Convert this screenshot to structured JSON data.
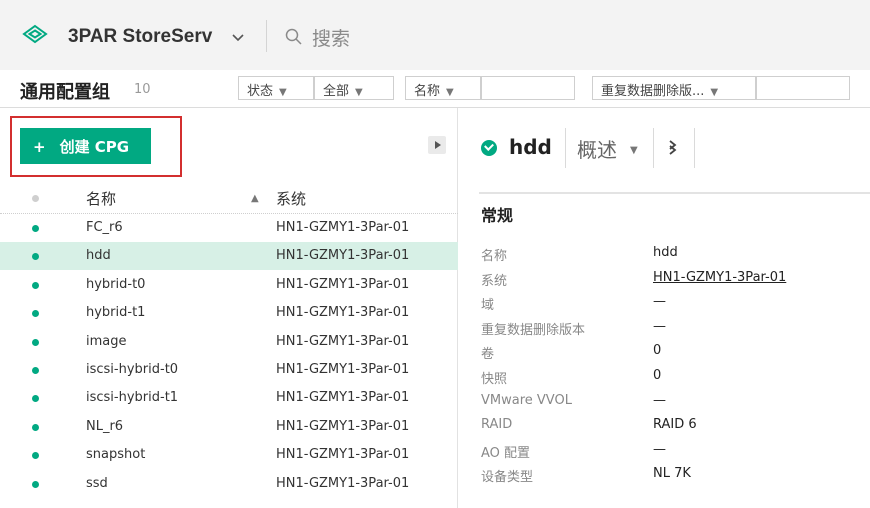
{
  "header": {
    "product_name": "3PAR StoreServ",
    "search_placeholder": "搜索"
  },
  "filterbar": {
    "title": "通用配置组",
    "count": "10",
    "filters": [
      {
        "label": "状态",
        "value": "全部"
      },
      {
        "label": "名称",
        "value": ""
      },
      {
        "label": "重复数据删除版...",
        "value": ""
      }
    ]
  },
  "actions": {
    "create_label": "创建 CPG",
    "plus": "+"
  },
  "table": {
    "columns": {
      "name": "名称",
      "system": "系统"
    },
    "sort_indicator": "▲",
    "rows": [
      {
        "name": "FC_r6",
        "system": "HN1-GZMY1-3Par-01",
        "selected": false
      },
      {
        "name": "hdd",
        "system": "HN1-GZMY1-3Par-01",
        "selected": true
      },
      {
        "name": "hybrid-t0",
        "system": "HN1-GZMY1-3Par-01",
        "selected": false
      },
      {
        "name": "hybrid-t1",
        "system": "HN1-GZMY1-3Par-01",
        "selected": false
      },
      {
        "name": "image",
        "system": "HN1-GZMY1-3Par-01",
        "selected": false
      },
      {
        "name": "iscsi-hybrid-t0",
        "system": "HN1-GZMY1-3Par-01",
        "selected": false
      },
      {
        "name": "iscsi-hybrid-t1",
        "system": "HN1-GZMY1-3Par-01",
        "selected": false
      },
      {
        "name": "NL_r6",
        "system": "HN1-GZMY1-3Par-01",
        "selected": false
      },
      {
        "name": "snapshot",
        "system": "HN1-GZMY1-3Par-01",
        "selected": false
      },
      {
        "name": "ssd",
        "system": "HN1-GZMY1-3Par-01",
        "selected": false
      }
    ]
  },
  "detail": {
    "name": "hdd",
    "view": "概述",
    "section": "常规",
    "properties": [
      {
        "label": "名称",
        "value": "hdd"
      },
      {
        "label": "系统",
        "value": "HN1-GZMY1-3Par-01",
        "link": true
      },
      {
        "label": "域",
        "value": "—"
      },
      {
        "label": "重复数据删除版本",
        "value": "—"
      },
      {
        "label": "卷",
        "value": "0"
      },
      {
        "label": "快照",
        "value": "0"
      },
      {
        "label": "VMware VVOL",
        "value": "—"
      },
      {
        "label": "RAID",
        "value": "RAID 6"
      },
      {
        "label": "AO 配置",
        "value": "—"
      },
      {
        "label": "设备类型",
        "value": "NL 7K"
      }
    ]
  },
  "colors": {
    "accent": "#01a982",
    "selection": "#d7f0e6",
    "highlight": "#d32f2f"
  }
}
